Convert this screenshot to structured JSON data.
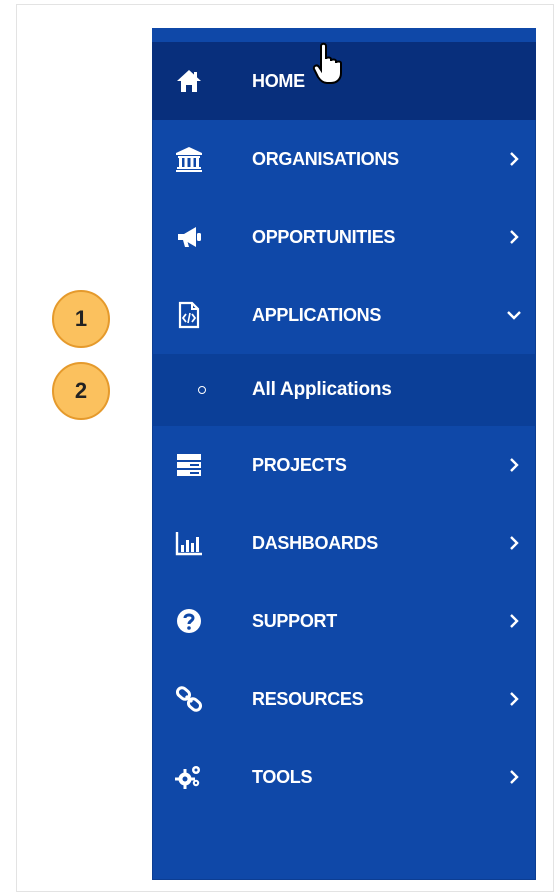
{
  "nav": {
    "items": [
      {
        "label": "HOME",
        "icon": "home-icon"
      },
      {
        "label": "ORGANISATIONS",
        "icon": "bank-icon"
      },
      {
        "label": "OPPORTUNITIES",
        "icon": "megaphone-icon"
      },
      {
        "label": "APPLICATIONS",
        "icon": "code-file-icon"
      },
      {
        "label": "All Applications",
        "icon": "circle-bullet-icon"
      },
      {
        "label": "PROJECTS",
        "icon": "server-stack-icon"
      },
      {
        "label": "DASHBOARDS",
        "icon": "bar-chart-icon"
      },
      {
        "label": "SUPPORT",
        "icon": "question-circle-icon"
      },
      {
        "label": "RESOURCES",
        "icon": "link-icon"
      },
      {
        "label": "TOOLS",
        "icon": "gears-icon"
      }
    ]
  },
  "annotations": [
    {
      "number": "1"
    },
    {
      "number": "2"
    }
  ],
  "colors": {
    "sidebar_bg": "#0f48a8",
    "active_bg": "#082f7c",
    "submenu_bg": "#0b3f98",
    "badge_fill": "#fbc15e",
    "badge_border": "#e59a2c"
  }
}
